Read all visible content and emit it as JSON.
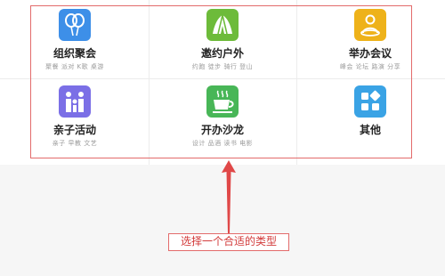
{
  "categories": [
    {
      "title": "组织聚会",
      "tags": "聚餐 派对 K歌 桌游",
      "icon": "balloon-icon",
      "color": "#3d8fe8"
    },
    {
      "title": "邀约户外",
      "tags": "约跑 徒步 骑行 登山",
      "icon": "tent-icon",
      "color": "#6dbb3a"
    },
    {
      "title": "举办会议",
      "tags": "峰会 论坛 路演 分享",
      "icon": "meeting-icon",
      "color": "#eeb21a"
    },
    {
      "title": "亲子活动",
      "tags": "亲子 早教 文艺",
      "icon": "family-icon",
      "color": "#7b6fe6"
    },
    {
      "title": "开办沙龙",
      "tags": "设计 品酒 读书 电影",
      "icon": "coffee-cup-icon",
      "color": "#48b657"
    },
    {
      "title": "其他",
      "tags": "",
      "icon": "grid-icon",
      "color": "#3aa3e5"
    }
  ],
  "annotation": {
    "label": "选择一个合适的类型",
    "border_color": "#e36b6b",
    "text_color": "#d23a3a"
  }
}
